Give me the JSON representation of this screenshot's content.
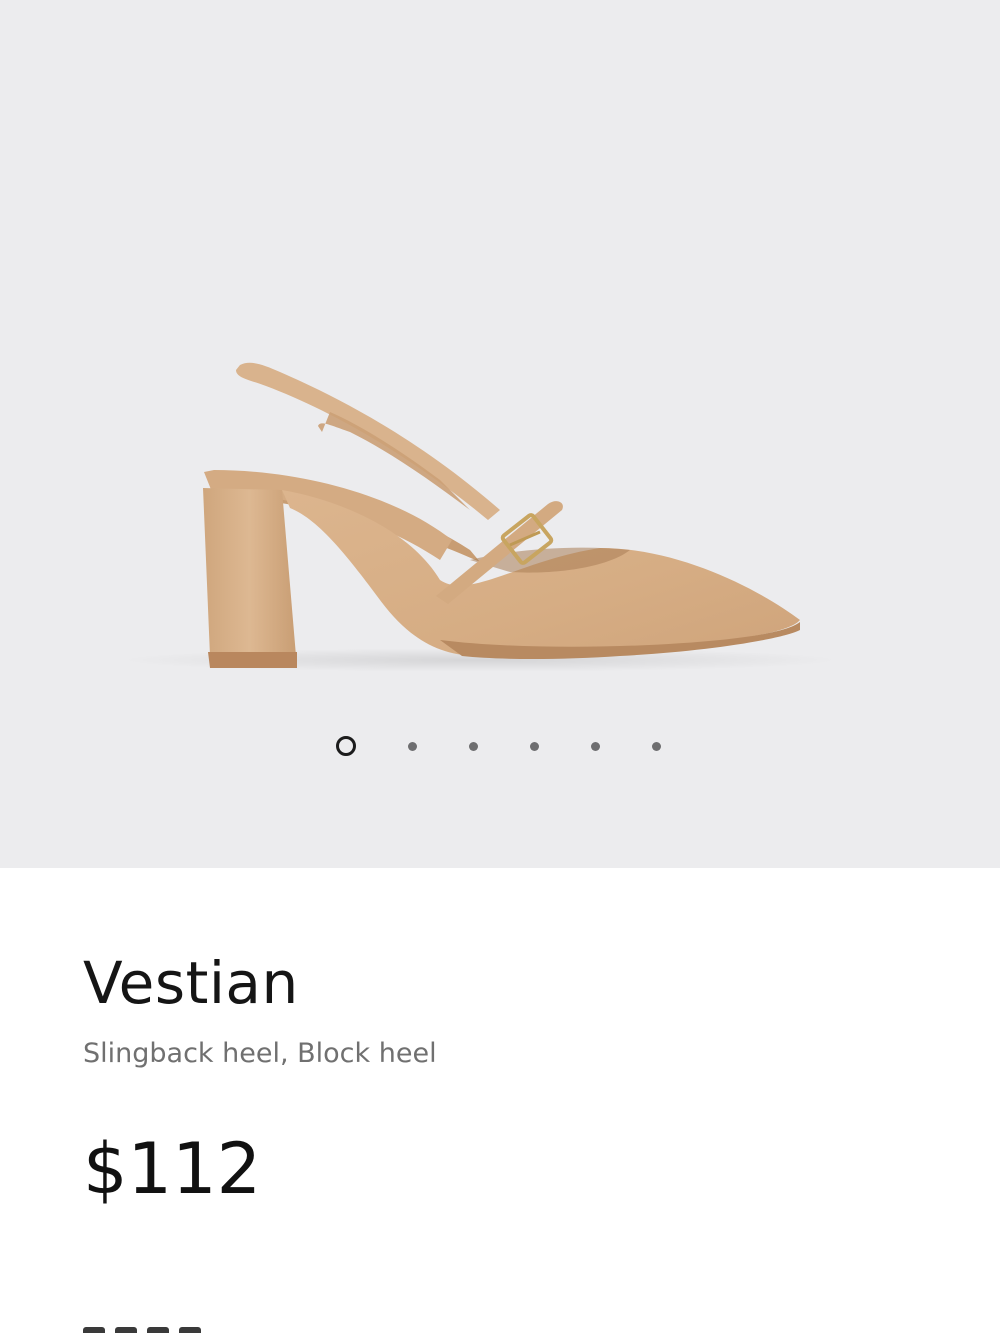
{
  "gallery": {
    "image_alt": "Vestian",
    "product_color": "#d8b18a",
    "background_color": "#ececee",
    "dot_count": 6,
    "active_index": 0
  },
  "product": {
    "name": "Vestian",
    "subtitle": "Slingback heel, Block heel",
    "price": "$112"
  }
}
